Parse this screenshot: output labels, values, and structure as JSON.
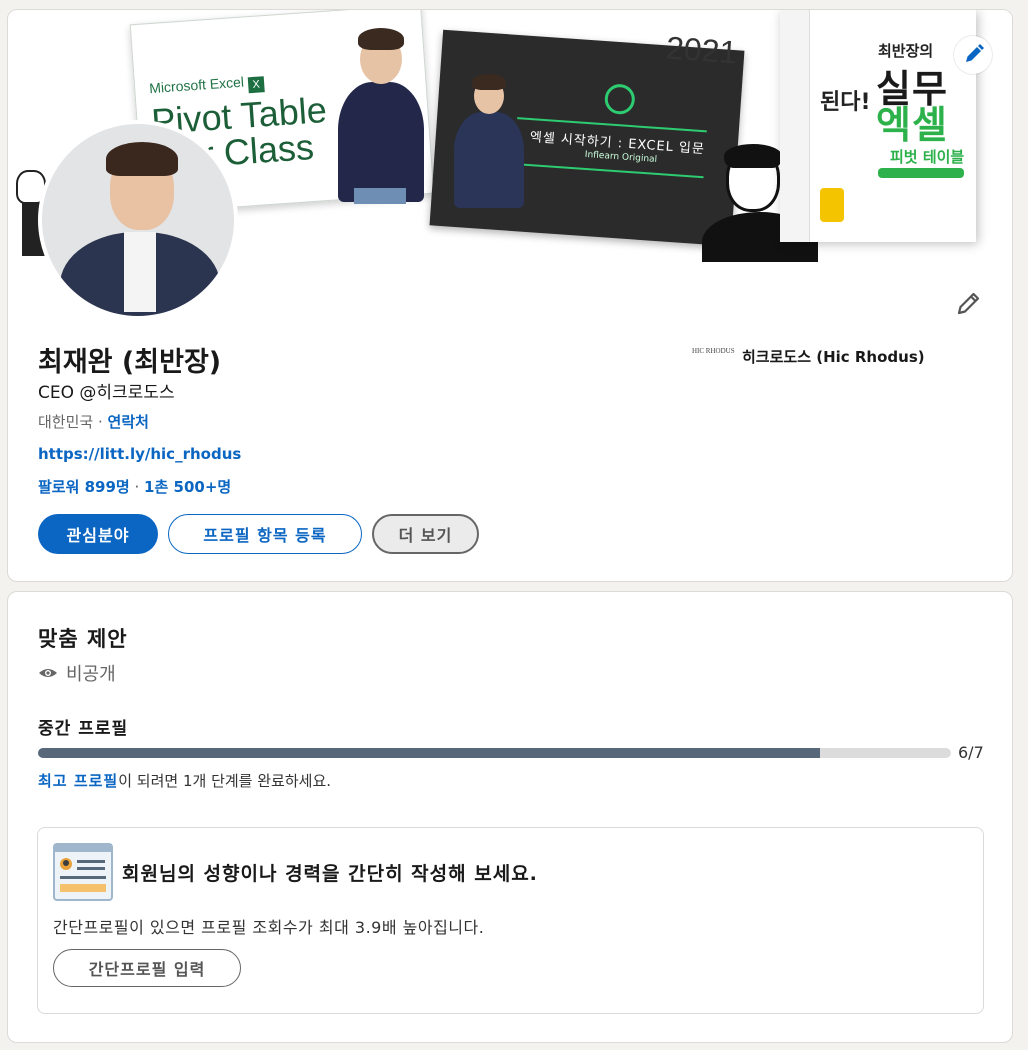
{
  "banner": {
    "excel_slide_brand": "Microsoft Excel",
    "excel_slide_icon": "X",
    "excel_slide_title_1": "Pivot Table",
    "excel_slide_title_2": "ster Class",
    "year": "2021",
    "dark_slide_title": "엑셀 시작하기 : EXCEL 입문",
    "dark_slide_subtitle": "Inflearn Original",
    "book_side": "된다!",
    "book_title_1": "최반장의",
    "book_title_2": "실무",
    "book_title_3": "엑셀",
    "book_title_4": "피벗 테이블",
    "edit_icon": "pencil-icon"
  },
  "profile": {
    "name": "최재완 (최반장)",
    "headline": "CEO @히크로도스",
    "location": "대한민국",
    "location_sep": " · ",
    "contact_label": "연락처",
    "website": "https://litt.ly/hic_rhodus",
    "followers": "팔로워 899명",
    "network_sep": " · ",
    "connections": "1촌 500+명",
    "company_logo_text": "HIC RHODUS",
    "company_name": "히크로도스 (Hic Rhodus)",
    "buttons": {
      "interests": "관심분야",
      "add_section": "프로필 항목 등록",
      "more": "더 보기"
    }
  },
  "suggestions": {
    "title": "맞춤 제안",
    "visibility": "비공개",
    "level": "중간 프로필",
    "progress_value": 0.857,
    "progress_label": "6/7",
    "hint_link": "최고 프로필",
    "hint_rest": "이 되려면 1개 단계를 완료하세요.",
    "card": {
      "title": "회원님의 성향이나 경력을 간단히 작성해 보세요.",
      "description": "간단프로필이 있으면 프로필 조회수가 최대 3.9배 높아집니다.",
      "button": "간단프로필 입력"
    }
  },
  "colors": {
    "accent": "#0a66c2",
    "progress_fill": "#56687a",
    "page_bg": "#f3f2ef"
  }
}
